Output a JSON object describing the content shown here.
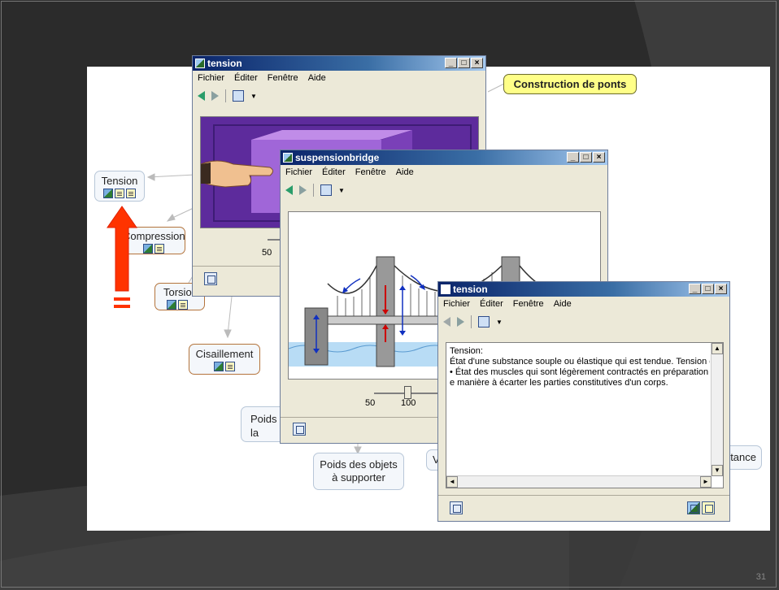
{
  "slide": {
    "page_number": "31"
  },
  "concept_map": {
    "nodes": {
      "tension": "Tension",
      "compression": "Compression",
      "torsion": "Torsion",
      "cisaillement": "Cisaillement",
      "construction": "Construction de ponts",
      "poids_structure": "Poids de la structure",
      "poids_objets_line1": "Poids des objets",
      "poids_objets_line2": "à supporter",
      "v_partial": "V",
      "resistance_partial": "Résistance"
    }
  },
  "win_tension_back": {
    "title": "tension",
    "menu": [
      "Fichier",
      "Éditer",
      "Fenêtre",
      "Aide"
    ],
    "slider_label": "50"
  },
  "win_bridge": {
    "title": "suspensionbridge",
    "menu": [
      "Fichier",
      "Éditer",
      "Fenêtre",
      "Aide"
    ],
    "tick_labels": [
      "50",
      "100"
    ]
  },
  "win_tension_front": {
    "title": "tension",
    "menu": [
      "Fichier",
      "Éditer",
      "Fenêtre",
      "Aide"
    ],
    "text_lines": [
      "Tension:",
      "État d'une substance souple ou élastique qui est tendue. Tension d",
      "• État des muscles qui sont légèrement contractés en préparation à",
      "e manière à écarter les parties constitutives d'un corps."
    ]
  },
  "window_buttons": {
    "minimize": "_",
    "maximize": "□",
    "close": "×"
  },
  "colors": {
    "title_bar": "#0a246a",
    "accent_arrow": "#ff3300",
    "yellow_node": "#ffff88"
  }
}
